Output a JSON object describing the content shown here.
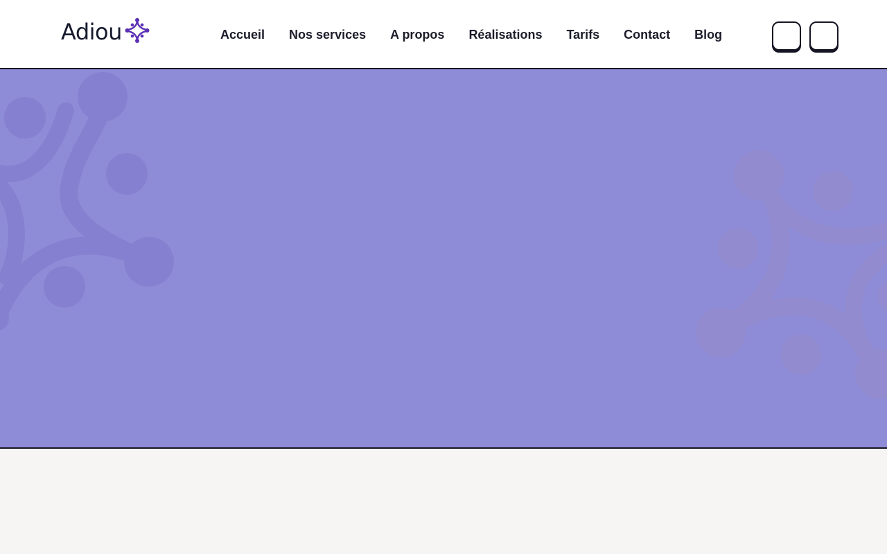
{
  "header": {
    "logo_text": "Adiou",
    "logo_icon": "sparkle-molecule-icon",
    "nav": [
      {
        "label": "Accueil"
      },
      {
        "label": "Nos services"
      },
      {
        "label": "A propos"
      },
      {
        "label": "Réalisations"
      },
      {
        "label": "Tarifs"
      },
      {
        "label": "Contact"
      },
      {
        "label": "Blog"
      }
    ],
    "buttons": [
      {
        "icon": "blank-icon"
      },
      {
        "icon": "blank-icon"
      }
    ]
  },
  "hero": {
    "decoration_left": "molecule-pattern-icon",
    "decoration_right": "molecule-pattern-icon"
  },
  "colors": {
    "brand": "#5b2fb4",
    "hero_bg": "#8f8cd7",
    "text": "#1c1c2a",
    "border": "#141422",
    "page_bg": "#f6f5f3"
  }
}
